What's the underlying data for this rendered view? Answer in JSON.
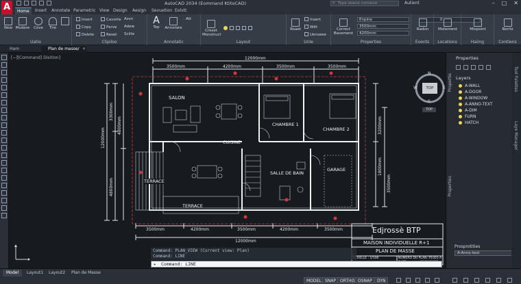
{
  "app": {
    "logo_letter": "A",
    "window_title": "AutoCAD 2034 (Eommand KtitoCAD)",
    "search_placeholder": "Type seaice comaine",
    "user": "Autient"
  },
  "ribbon_tabs": [
    "Home",
    "Insert",
    "Annotate",
    "Parametric",
    "View",
    "Design",
    "Aesign",
    "Sevuetion",
    "Eolvtt"
  ],
  "ribbon": {
    "draw": {
      "line": "New",
      "polyline": "Modere",
      "circle": "Cove",
      "arc": "Tire",
      "label": "Uatio"
    },
    "modify": {
      "items": [
        "Insert",
        "Copy",
        "Delete",
        "Cavorte",
        "Parve",
        "Reset",
        "Azvn",
        "Adew",
        "Sciite"
      ],
      "label": "Clipiloo"
    },
    "annotation": {
      "text": "Top",
      "dimension": "Annotate",
      "label": "Annotatic",
      "mini": "Att"
    },
    "layers": {
      "btn1": "Creset",
      "btn1b": "Monstruct",
      "current_layer": "0",
      "label": "Layout"
    },
    "block": {
      "items": [
        "Insert",
        "Witt",
        "Uenseee"
      ],
      "rotate": "Roaet",
      "label": "Unle"
    },
    "properties": {
      "color": "Enpine",
      "lineweight": "3500mm",
      "linetype": "4200mm",
      "correct": "Correct",
      "correct2": "Bavement",
      "label": "Properties"
    },
    "events": {
      "label": "Events",
      "btn": "Radon"
    },
    "groups": {
      "label": "Locations",
      "btn": "Motement"
    },
    "utilities": {
      "label": "Haiing",
      "btn": "Mixpoint"
    },
    "clipboard": {
      "label": "Contiens",
      "btn": "Berits"
    }
  },
  "doc_tabs": [
    "Ham",
    "Plan de masse/"
  ],
  "viewport_label": "[−][Command] Disition]",
  "drawing": {
    "total_width": "12000mm",
    "top_dims": [
      "3500mm",
      "4200mm",
      "3500mm",
      "3500mm"
    ],
    "bottom_dims": [
      "3500mm",
      "4200mm",
      "3500mm",
      "4200mm",
      "3500mm"
    ],
    "bottom_total": "12000mm",
    "left_dims": [
      "3300mm",
      "4800mm",
      "4800mm"
    ],
    "left_total": "12000mm",
    "right_dims": [
      "3200mm",
      "1800mm",
      "3500mm"
    ],
    "rooms": {
      "salon": "SALON",
      "cuisine": "CUISINE",
      "chambre1": "CHAMBRE 1",
      "chambre2": "CHAMBRE 2",
      "terrace_left": "TERRACE",
      "terrace_bottom": "TERRACE",
      "salle": "SALLE DE BAIN",
      "garage": "GARAGE"
    }
  },
  "title_block": {
    "company": "Edjrossè BTP",
    "project": "MAISON INDIVIDUELLE R+1",
    "sheet": "PLAN DE MASSE",
    "scale": "ECHELLE : 1/100",
    "plan_no": "NUMERO DU PLAN: P1001-A",
    "date_label": "DATE",
    "date": "20/10/2025"
  },
  "viewcube": {
    "top": "TOP",
    "n": "N",
    "s": "S",
    "e": "E",
    "w": "W",
    "under": "TOP"
  },
  "right_panel": {
    "title": "Properties",
    "layers_title": "Layers",
    "layers": [
      "A-WALL",
      "A-DOOR",
      "A-WINDOW",
      "A-ANNO-TEXT",
      "A-DIM",
      "FURN",
      "HATCH"
    ],
    "props_title": "Prosprotities",
    "props_value": "A-Anno-text",
    "tab_vertical1": "Propertie",
    "tab_vertical2": "Properties",
    "far_tab1": "Tool Palettes",
    "far_tab2": "Laye Manager"
  },
  "command": {
    "history1": "Command: PLAN_VIEW (Current view: Plan)",
    "history2": "Command: LINE",
    "current": "Command: LINE"
  },
  "layout_tabs": [
    "Model",
    "Layout1",
    "Layout2",
    "Plan de Masse"
  ],
  "status_buttons": [
    "MODEL",
    "SNAP",
    "ORTHO",
    "OSNAP",
    "DYN"
  ]
}
